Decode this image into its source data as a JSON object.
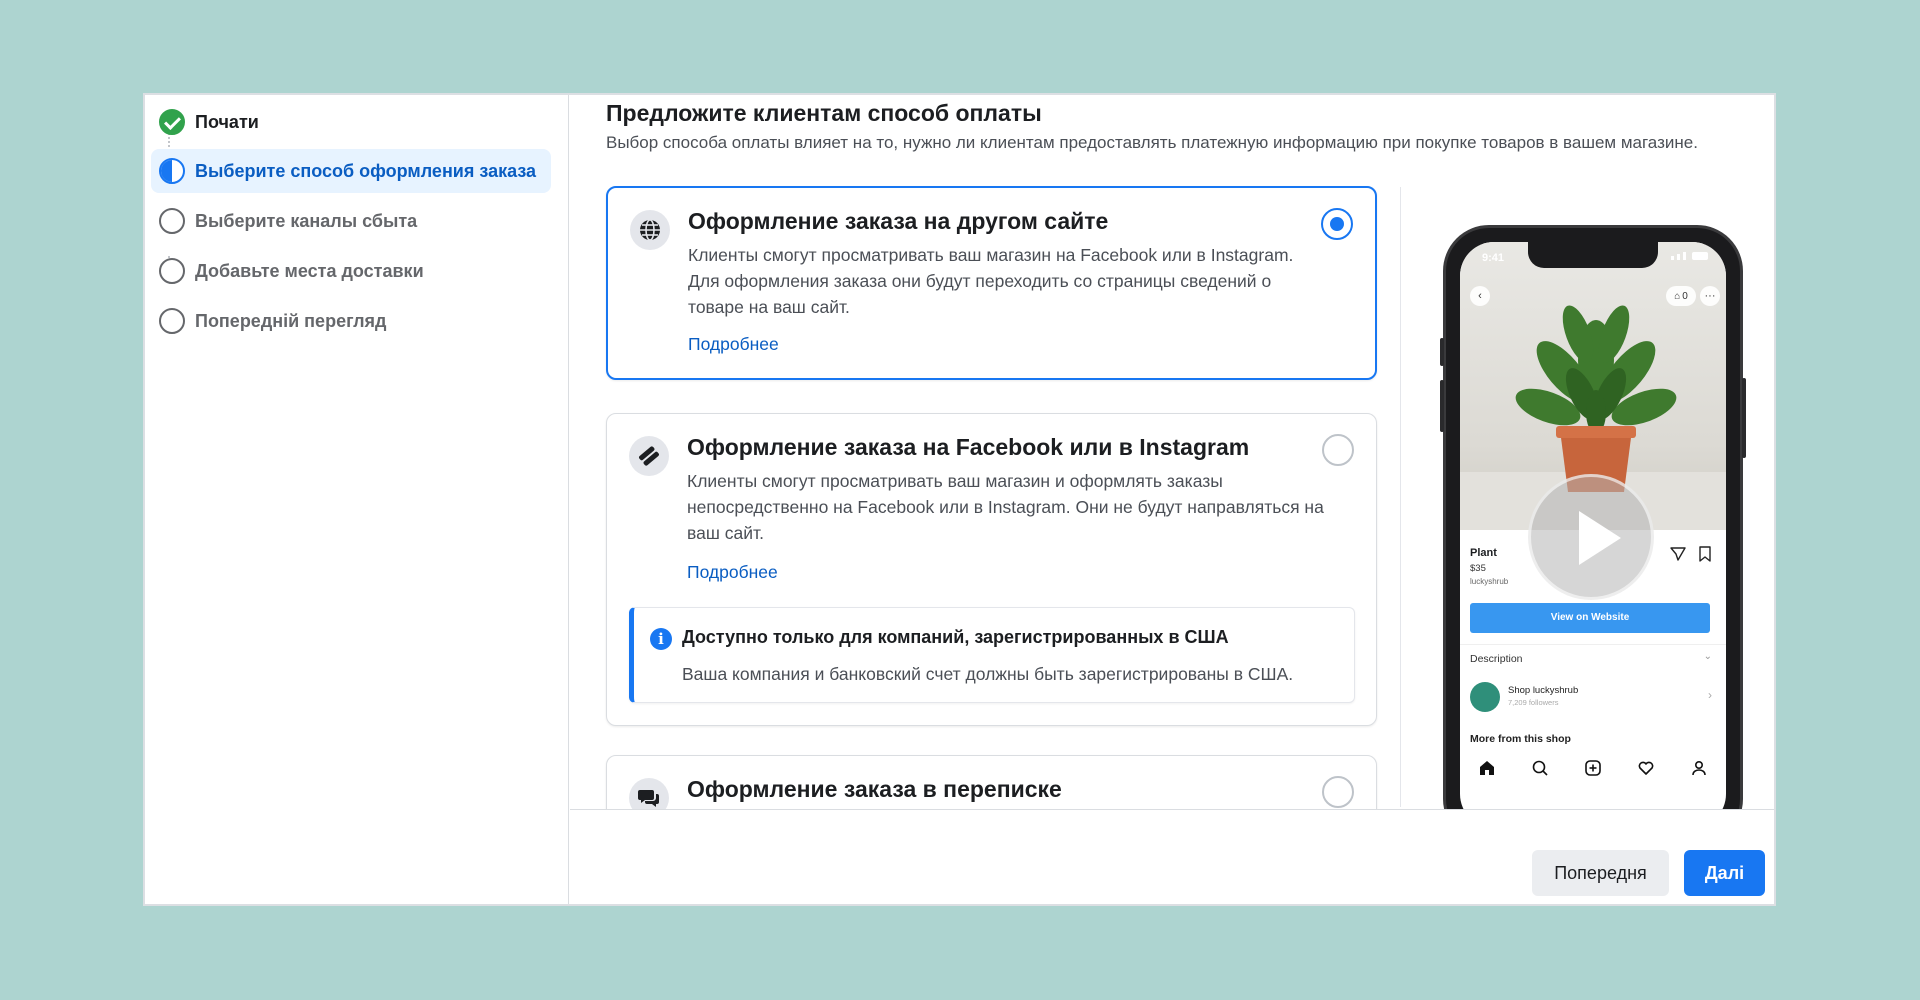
{
  "sidebar": {
    "steps": [
      {
        "label": "Почати",
        "state": "done"
      },
      {
        "label": "Выберите способ оформления заказа",
        "state": "active"
      },
      {
        "label": "Выберите каналы сбыта",
        "state": "pending"
      },
      {
        "label": "Добавьте места доставки",
        "state": "pending"
      },
      {
        "label": "Попередній перегляд",
        "state": "pending"
      }
    ]
  },
  "main": {
    "title": "Предложите клиентам способ оплаты",
    "subtitle": "Выбор способа оплаты влияет на то, нужно ли клиентам предоставлять платежную информацию при покупке товаров в вашем магазине.",
    "options": [
      {
        "title": "Оформление заказа на другом сайте",
        "description": "Клиенты смогут просматривать ваш магазин на Facebook или в Instagram. Для оформления заказа они будут переходить со страницы сведений о товаре на ваш сайт.",
        "link": "Подробнее",
        "selected": true
      },
      {
        "title": "Оформление заказа на Facebook или в Instagram",
        "description": "Клиенты смогут просматривать ваш магазин и оформлять заказы непосредственно на Facebook или в Instagram. Они не будут направляться на ваш сайт.",
        "link": "Подробнее",
        "selected": false,
        "notice": {
          "title": "Доступно только для компаний, зарегистрированных в США",
          "text": "Ваша компания и банковский счет должны быть зарегистрированы в США."
        }
      },
      {
        "title": "Оформление заказа в переписке",
        "selected": false
      }
    ]
  },
  "preview": {
    "time": "9:41",
    "bag_count": "0",
    "product_name": "Plant",
    "price": "$35",
    "seller": "luckyshrub",
    "view_button": "View on Website",
    "description_label": "Description",
    "shop_name": "Shop luckyshrub",
    "shop_followers": "7,209 followers",
    "more_label": "More from this shop"
  },
  "footer": {
    "prev_label": "Попередня",
    "next_label": "Далі"
  },
  "colors": {
    "accent": "#1877f2",
    "success": "#31a24c",
    "page_background": "#add4d0"
  }
}
